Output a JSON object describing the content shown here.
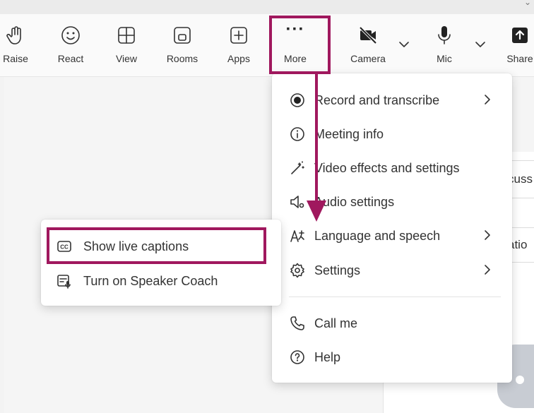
{
  "toolbar": {
    "items": [
      {
        "label": "Raise",
        "icon": "hand-icon"
      },
      {
        "label": "React",
        "icon": "smiley-icon"
      },
      {
        "label": "View",
        "icon": "grid-icon"
      },
      {
        "label": "Rooms",
        "icon": "rooms-icon"
      },
      {
        "label": "Apps",
        "icon": "plus-square-icon"
      },
      {
        "label": "More",
        "icon": "ellipsis-icon"
      },
      {
        "label": "Camera",
        "icon": "camera-off-icon"
      },
      {
        "label": "Mic",
        "icon": "mic-icon"
      },
      {
        "label": "Share",
        "icon": "share-icon"
      }
    ],
    "more_glyph": "···"
  },
  "more_menu": {
    "items": [
      {
        "label": "Record and transcribe",
        "icon": "record-icon",
        "has_submenu": true
      },
      {
        "label": "Meeting info",
        "icon": "info-icon",
        "has_submenu": false
      },
      {
        "label": "Video effects and settings",
        "icon": "magic-wand-icon",
        "has_submenu": false
      },
      {
        "label": "Audio settings",
        "icon": "speaker-settings-icon",
        "has_submenu": false
      },
      {
        "label": "Language and speech",
        "icon": "language-icon",
        "has_submenu": true
      },
      {
        "label": "Settings",
        "icon": "gear-icon",
        "has_submenu": true
      },
      {
        "label": "Call me",
        "icon": "phone-icon",
        "has_submenu": false
      },
      {
        "label": "Help",
        "icon": "help-icon",
        "has_submenu": false
      }
    ]
  },
  "language_submenu": {
    "items": [
      {
        "label": "Show live captions",
        "icon": "cc-icon",
        "highlighted": true
      },
      {
        "label": "Turn on Speaker Coach",
        "icon": "speaker-coach-icon",
        "highlighted": false
      }
    ]
  },
  "background_panel": {
    "card1_text": "cuss",
    "card2_text": "atio"
  },
  "colors": {
    "highlight": "#a0185e",
    "menu_bg": "#ffffff",
    "toolbar_bg": "#fafafa"
  }
}
